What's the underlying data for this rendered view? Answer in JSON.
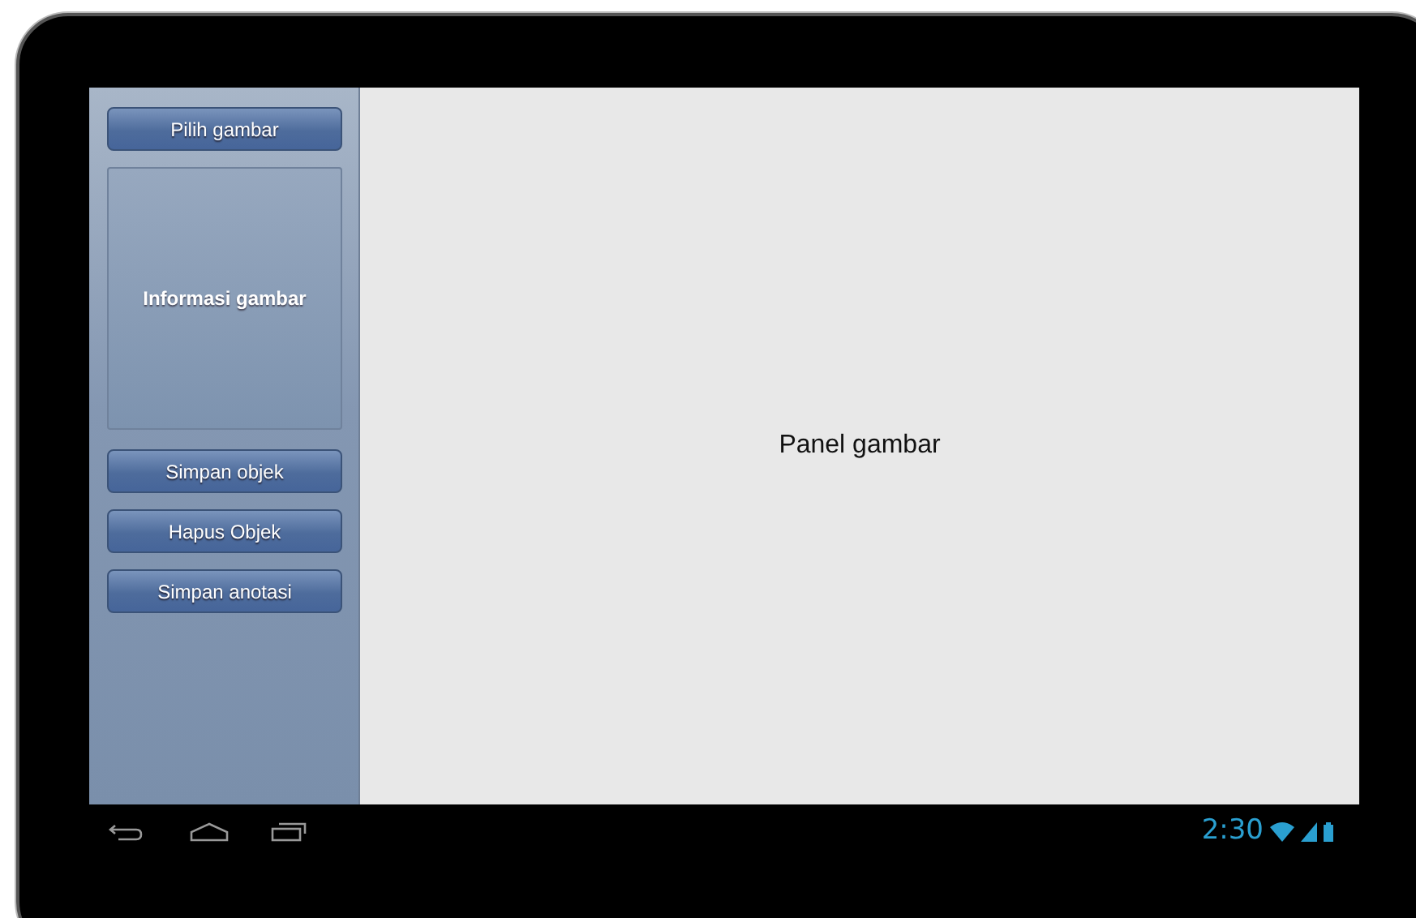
{
  "sidebar": {
    "top_button": "Pilih gambar",
    "info_panel": "Informasi gambar",
    "buttons": [
      "Simpan objek",
      "Hapus Objek",
      "Simpan anotasi"
    ]
  },
  "main_panel": {
    "label": "Panel gambar"
  },
  "system_bar": {
    "time": "2:30"
  }
}
